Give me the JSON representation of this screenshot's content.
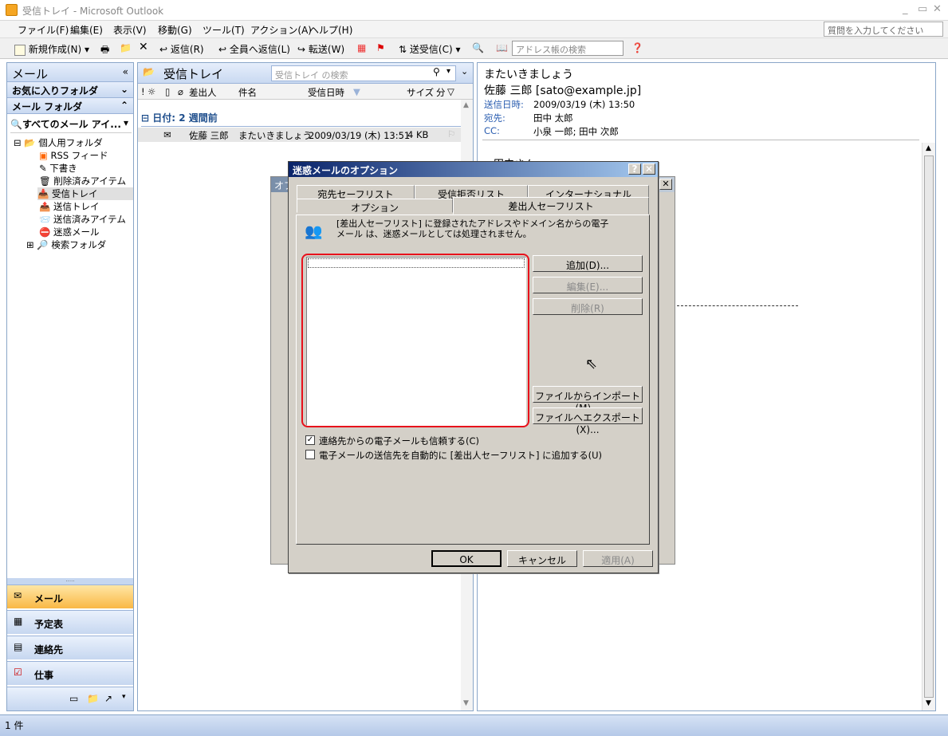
{
  "window": {
    "title": "受信トレイ - Microsoft Outlook"
  },
  "menu": [
    "ファイル(F)",
    "編集(E)",
    "表示(V)",
    "移動(G)",
    "ツール(T)",
    "アクション(A)",
    "ヘルプ(H)"
  ],
  "help_placeholder": "質問を入力してください",
  "toolbar": {
    "new": "新規作成(N)",
    "reply": "返信(R)",
    "reply_all": "全員へ返信(L)",
    "forward": "転送(W)",
    "send_receive": "送受信(C)",
    "address_search": "アドレス帳の検索"
  },
  "nav": {
    "title": "メール",
    "favorites": "お気に入りフォルダ",
    "mail_folders": "メール フォルダ",
    "all_items": "すべてのメール アイ...",
    "tree": [
      "個人用フォルダ",
      "RSS フィード",
      "下書き",
      "削除済みアイテム",
      "受信トレイ",
      "送信トレイ",
      "送信済みアイテム",
      "迷惑メール",
      "検索フォルダ"
    ],
    "buttons": [
      "メール",
      "予定表",
      "連絡先",
      "仕事"
    ]
  },
  "list": {
    "title": "受信トレイ",
    "search_placeholder": "受信トレイ の検索",
    "columns": {
      "from": "差出人",
      "subject": "件名",
      "received": "受信日時",
      "size": "サイズ",
      "cat": "分"
    },
    "group": "日付: 2 週間前",
    "message": {
      "from": "佐藤 三郎",
      "subject": "またいきましょう",
      "received": "2009/03/19 (木) 13:51",
      "size": "4 KB"
    }
  },
  "reading": {
    "subject": "またいきましょう",
    "sender": "佐藤 三郎 [sato@example.jp]",
    "sent_label": "送信日時:",
    "sent": "2009/03/19 (木) 13:50",
    "to_label": "宛先:",
    "to": "田中 太郎",
    "cc_label": "CC:",
    "cc": "小泉 一郎; 田中 次郎",
    "body_start": "田中さん"
  },
  "bg_dialog": {
    "title": "オプ"
  },
  "dialog": {
    "title": "迷惑メールのオプション",
    "tabs_back": [
      "宛先セーフリスト",
      "受信拒否リスト",
      "インターナショナル"
    ],
    "tabs_front": [
      "オプション",
      "差出人セーフリスト"
    ],
    "description": "[差出人セーフリスト] に登録されたアドレスやドメイン名からの電子メール は、迷惑メールとしては処理されません。",
    "buttons": {
      "add": "追加(D)...",
      "edit": "編集(E)...",
      "remove": "削除(R)",
      "import": "ファイルからインポート(M)...",
      "export": "ファイルへエクスポート(X)..."
    },
    "check_trust": "連絡先からの電子メールも信頼する(C)",
    "check_auto_add": "電子メールの送信先を自動的に [差出人セーフリスト] に追加する(U)",
    "ok": "OK",
    "cancel": "キャンセル",
    "apply": "適用(A)",
    "check_trust_checked": true,
    "check_auto_add_checked": false
  },
  "status": "1 件",
  "colors": {
    "accent": "#0a246a",
    "highlight_red": "#e8101b",
    "nav_selected": "#f9b845"
  }
}
